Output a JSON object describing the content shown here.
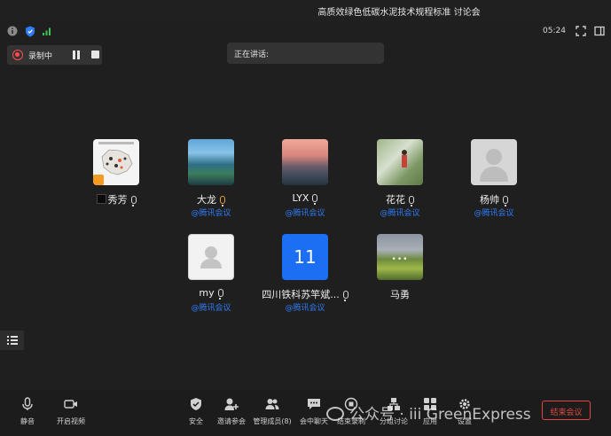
{
  "window": {
    "title": "高质效绿色低碳水泥技术规程标准 讨论会"
  },
  "status": {
    "timer": "05:24"
  },
  "recording": {
    "label": "录制中"
  },
  "speaking": {
    "label": "正在讲话:"
  },
  "participants": [
    {
      "name": "秀芳",
      "sub": ""
    },
    {
      "name": "大龙",
      "sub": "@腾讯会议"
    },
    {
      "name": "LYX",
      "sub": "@腾讯会议"
    },
    {
      "name": "花花",
      "sub": "@腾讯会议"
    },
    {
      "name": "杨帅",
      "sub": "@腾讯会议"
    },
    {
      "name": "my",
      "sub": "@腾讯会议"
    },
    {
      "name": "四川铁科苏竿斌...",
      "sub": "@腾讯会议",
      "avatar_text": "11"
    },
    {
      "name": "马勇",
      "sub": ""
    }
  ],
  "toolbar": {
    "items": [
      {
        "label": "静音",
        "icon": "mic-icon"
      },
      {
        "label": "开启视频",
        "icon": "camera-icon"
      },
      {
        "label": "安全",
        "icon": "shield-icon"
      },
      {
        "label": "邀请参会",
        "icon": "invite-user-icon"
      },
      {
        "label": "管理成员(8)",
        "icon": "members-icon"
      },
      {
        "label": "会中聊天",
        "icon": "chat-icon"
      },
      {
        "label": "结束录制",
        "icon": "record-stop-icon"
      },
      {
        "label": "分组讨论",
        "icon": "breakout-icon"
      },
      {
        "label": "应用",
        "icon": "apps-icon"
      },
      {
        "label": "设置",
        "icon": "gear-icon"
      }
    ],
    "end_label": "结束会议"
  },
  "watermark": {
    "text": "公众号 · iii GreenExpress"
  },
  "colors": {
    "accent": "#2f7bf6",
    "record": "#ff4d4f",
    "end": "#e0483f",
    "background": "#1f1f1f"
  }
}
